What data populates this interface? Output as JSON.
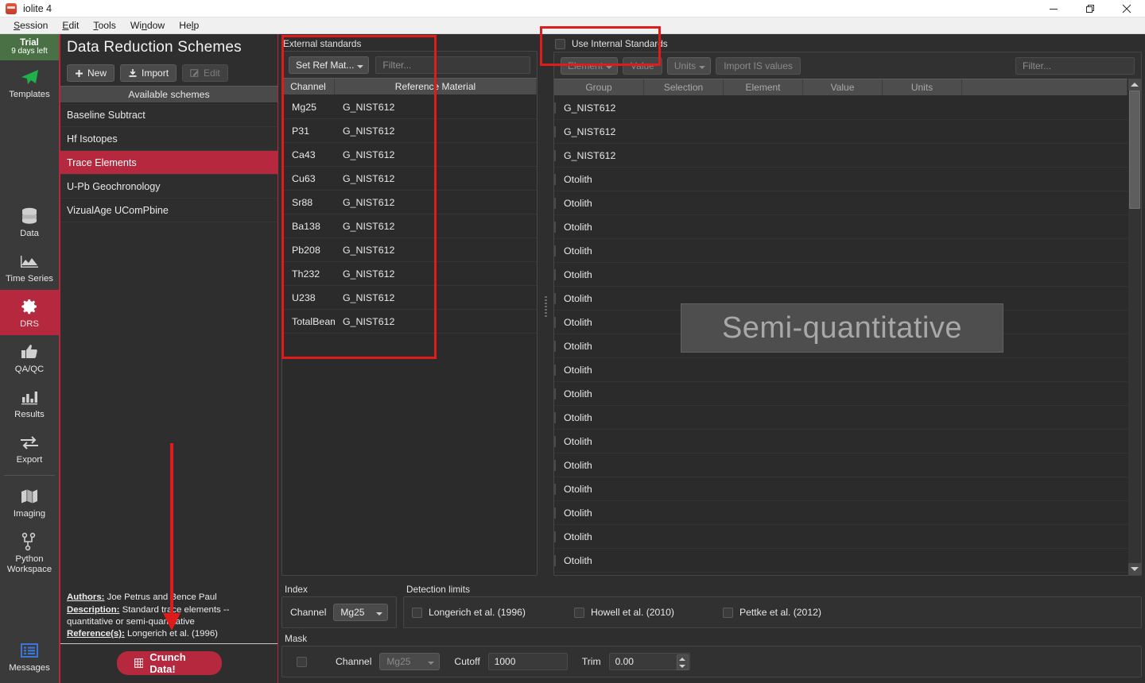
{
  "window": {
    "title": "iolite 4",
    "controls": {
      "minimize": "minimize-icon",
      "maximize": "maximize-icon",
      "close": "close-icon"
    }
  },
  "menubar": [
    {
      "label": "Session",
      "accel": "S"
    },
    {
      "label": "Edit",
      "accel": "E"
    },
    {
      "label": "Tools",
      "accel": "T"
    },
    {
      "label": "Window",
      "accel": "n"
    },
    {
      "label": "Help",
      "accel": "l"
    }
  ],
  "rail": {
    "trial": {
      "title": "Trial",
      "subtitle": "9 days left",
      "color": "#4a7145"
    },
    "items": [
      {
        "label": "Templates",
        "icon": "paper-plane-icon",
        "active": false
      },
      {
        "label": "Data",
        "icon": "database-icon",
        "active": false
      },
      {
        "label": "Time Series",
        "icon": "mountain-chart-icon",
        "active": false
      },
      {
        "label": "DRS",
        "icon": "gear-icon",
        "active": true
      },
      {
        "label": "QA/QC",
        "icon": "thumbs-up-icon",
        "active": false
      },
      {
        "label": "Results",
        "icon": "bar-chart-icon",
        "active": false
      },
      {
        "label": "Export",
        "icon": "arrows-exchange-icon",
        "active": false
      },
      {
        "label": "Imaging",
        "icon": "map-icon",
        "active": false
      },
      {
        "label": "Python Workspace",
        "icon": "node-graph-icon",
        "active": false
      }
    ],
    "messages": {
      "label": "Messages",
      "icon": "message-list-icon"
    },
    "accent": "#b5283d"
  },
  "schemes": {
    "title": "Data Reduction Schemes",
    "buttons": {
      "new": "New",
      "import": "Import",
      "edit": "Edit"
    },
    "available_header": "Available schemes",
    "items": [
      {
        "label": "Baseline Subtract",
        "selected": false
      },
      {
        "label": "Hf Isotopes",
        "selected": false
      },
      {
        "label": "Trace Elements",
        "selected": true
      },
      {
        "label": "U-Pb Geochronology",
        "selected": false
      },
      {
        "label": "VizualAge UComPbine",
        "selected": false
      }
    ],
    "meta": {
      "authors_label": "Authors:",
      "authors_value": " Joe Petrus and Bence Paul",
      "description_label": "Description:",
      "description_value": " Standard trace elements -- quantitative or semi-quantitative",
      "reference_label": "Reference(s):",
      "reference_value": " Longerich et al. (1996)"
    },
    "crunch_button": "Crunch Data!"
  },
  "external_standards": {
    "title": "External standards",
    "set_ref_mat_button": "Set Ref Mat...",
    "filter_placeholder": "Filter...",
    "columns": [
      "Channel",
      "Reference Material"
    ],
    "rows": [
      {
        "channel": "Mg25",
        "reference_material": "G_NIST612"
      },
      {
        "channel": "P31",
        "reference_material": "G_NIST612"
      },
      {
        "channel": "Ca43",
        "reference_material": "G_NIST612"
      },
      {
        "channel": "Cu63",
        "reference_material": "G_NIST612"
      },
      {
        "channel": "Sr88",
        "reference_material": "G_NIST612"
      },
      {
        "channel": "Ba138",
        "reference_material": "G_NIST612"
      },
      {
        "channel": "Pb208",
        "reference_material": "G_NIST612"
      },
      {
        "channel": "Th232",
        "reference_material": "G_NIST612"
      },
      {
        "channel": "U238",
        "reference_material": "G_NIST612"
      },
      {
        "channel": "TotalBeam",
        "reference_material": "G_NIST612"
      }
    ]
  },
  "internal_standards": {
    "checkbox_label": "Use Internal Standards",
    "checked": false,
    "buttons": {
      "element": "Element",
      "value": "Value",
      "units": "Units",
      "import_is": "Import IS values"
    },
    "filter_placeholder": "Filter...",
    "columns": [
      "Group",
      "Selection",
      "Element",
      "Value",
      "Units"
    ],
    "rows": [
      {
        "group": "G_NIST612"
      },
      {
        "group": "G_NIST612"
      },
      {
        "group": "G_NIST612"
      },
      {
        "group": "Otolith"
      },
      {
        "group": "Otolith"
      },
      {
        "group": "Otolith"
      },
      {
        "group": "Otolith"
      },
      {
        "group": "Otolith"
      },
      {
        "group": "Otolith"
      },
      {
        "group": "Otolith"
      },
      {
        "group": "Otolith"
      },
      {
        "group": "Otolith"
      },
      {
        "group": "Otolith"
      },
      {
        "group": "Otolith"
      },
      {
        "group": "Otolith"
      },
      {
        "group": "Otolith"
      },
      {
        "group": "Otolith"
      },
      {
        "group": "Otolith"
      },
      {
        "group": "Otolith"
      },
      {
        "group": "Otolith"
      }
    ],
    "watermark": "Semi-quantitative"
  },
  "bottom": {
    "index": {
      "title": "Index",
      "channel_label": "Channel",
      "channel_value": "Mg25"
    },
    "detection_limits": {
      "title": "Detection limits",
      "options": [
        {
          "label": "Longerich et al. (1996)",
          "checked": false
        },
        {
          "label": "Howell et al. (2010)",
          "checked": false
        },
        {
          "label": "Pettke et al. (2012)",
          "checked": false
        }
      ]
    },
    "mask": {
      "title": "Mask",
      "enabled": false,
      "channel_label": "Channel",
      "channel_value": "Mg25",
      "cutoff_label": "Cutoff",
      "cutoff_value": "1000",
      "trim_label": "Trim",
      "trim_value": "0.00"
    }
  },
  "annotations": {
    "color": "#e01b1b",
    "boxes": [
      "external-standards-highlight",
      "use-internal-standards-highlight"
    ],
    "arrow": "crunch-data-arrow"
  }
}
